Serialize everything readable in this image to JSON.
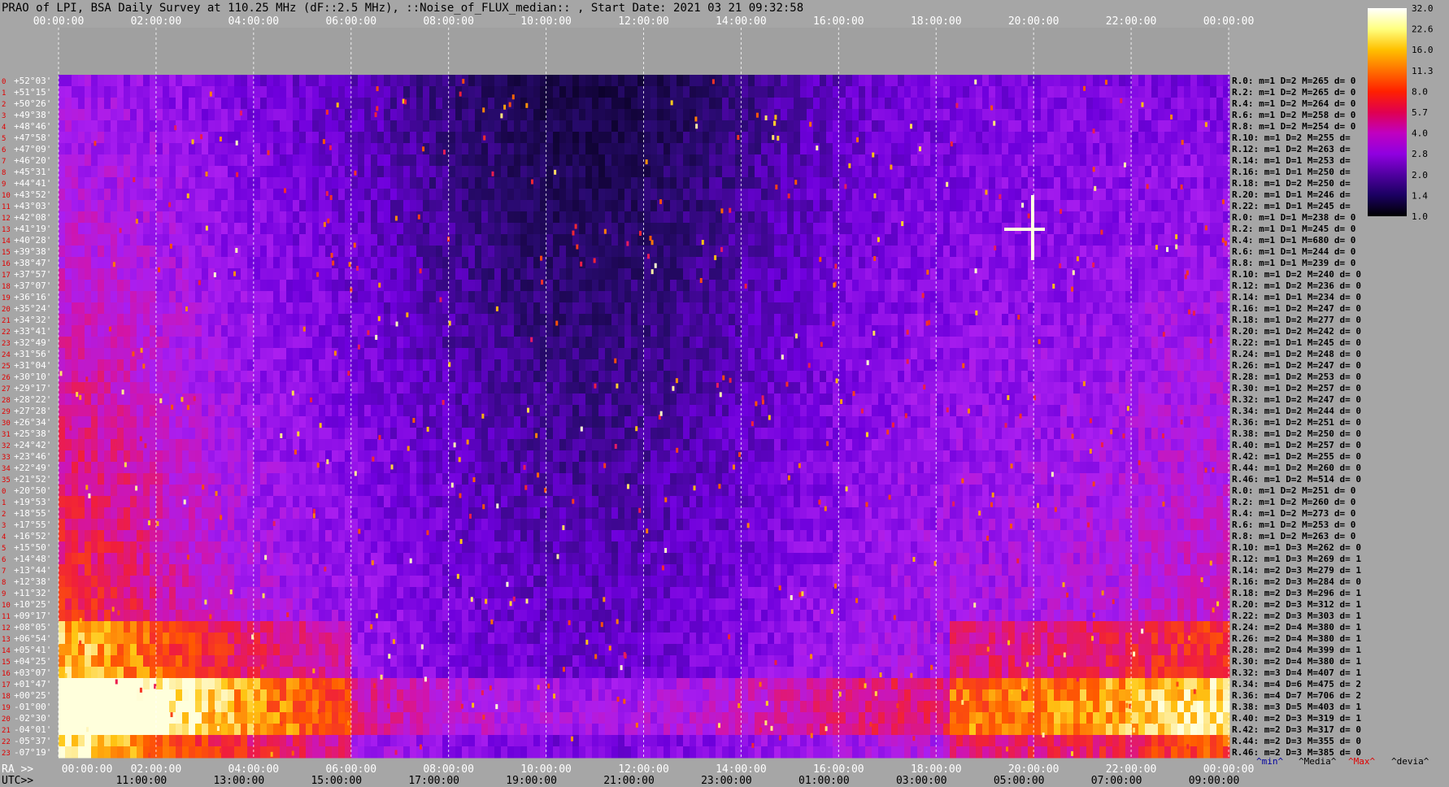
{
  "header": {
    "title": "PRAO of LPI, BSA Daily Survey at 110.25 MHz (dF::2.5 MHz), ::Noise_of_FLUX_median:: , Start Date: 2021 03 21 09:32:58"
  },
  "chart_data": {
    "type": "heatmap",
    "top_axis_ticks": [
      "00:00:00",
      "02:00:00",
      "04:00:00",
      "06:00:00",
      "08:00:00",
      "10:00:00",
      "12:00:00",
      "14:00:00",
      "16:00:00",
      "18:00:00",
      "20:00:00",
      "22:00:00",
      "00:00:00"
    ],
    "ra_axis": {
      "prefix": "RA >>",
      "ticks": [
        "00:00:00",
        "02:00:00",
        "04:00:00",
        "06:00:00",
        "08:00:00",
        "10:00:00",
        "12:00:00",
        "14:00:00",
        "16:00:00",
        "18:00:00",
        "20:00:00",
        "22:00:00",
        "00:00:00"
      ]
    },
    "utc_axis": {
      "prefix": "UTC>>",
      "ticks": [
        "11:00:00",
        "13:00:00",
        "15:00:00",
        "17:00:00",
        "19:00:00",
        "21:00:00",
        "23:00:00",
        "01:00:00",
        "03:00:00",
        "05:00:00",
        "07:00:00",
        "09:00:00"
      ]
    },
    "rows": [
      {
        "n": "0",
        "dec": "+52°03'",
        "s": "R.0: m=1 D=2 M=265 d= 0"
      },
      {
        "n": "1",
        "dec": "+51°15'",
        "s": "R.2: m=1 D=2 M=265 d= 0"
      },
      {
        "n": "2",
        "dec": "+50°26'",
        "s": "R.4: m=1 D=2 M=264 d= 0"
      },
      {
        "n": "3",
        "dec": "+49°38'",
        "s": "R.6: m=1 D=2 M=258 d= 0"
      },
      {
        "n": "4",
        "dec": "+48°46'",
        "s": "R.8: m=1 D=2 M=254 d= 0"
      },
      {
        "n": "5",
        "dec": "+47°58'",
        "s": "R.10: m=1 D=2 M=255 d="
      },
      {
        "n": "6",
        "dec": "+47°09'",
        "s": "R.12: m=1 D=2 M=263 d="
      },
      {
        "n": "7",
        "dec": "+46°20'",
        "s": "R.14: m=1 D=1 M=253 d="
      },
      {
        "n": "8",
        "dec": "+45°31'",
        "s": "R.16: m=1 D=1 M=250 d="
      },
      {
        "n": "9",
        "dec": "+44°41'",
        "s": "R.18: m=1 D=2 M=250 d="
      },
      {
        "n": "10",
        "dec": "+43°52'",
        "s": "R.20: m=1 D=1 M=246 d="
      },
      {
        "n": "11",
        "dec": "+43°03'",
        "s": "R.22: m=1 D=1 M=245 d="
      },
      {
        "n": "12",
        "dec": "+42°08'",
        "s": "R.0: m=1 D=1 M=238 d= 0"
      },
      {
        "n": "13",
        "dec": "+41°19'",
        "s": "R.2: m=1 D=1 M=245 d= 0"
      },
      {
        "n": "14",
        "dec": "+40°28'",
        "s": "R.4: m=1 D=1 M=680 d= 0"
      },
      {
        "n": "15",
        "dec": "+39°38'",
        "s": "R.6: m=1 D=1 M=244 d= 0"
      },
      {
        "n": "16",
        "dec": "+38°47'",
        "s": "R.8: m=1 D=1 M=239 d= 0"
      },
      {
        "n": "17",
        "dec": "+37°57'",
        "s": "R.10: m=1 D=2 M=240 d= 0"
      },
      {
        "n": "18",
        "dec": "+37°07'",
        "s": "R.12: m=1 D=2 M=236 d= 0"
      },
      {
        "n": "19",
        "dec": "+36°16'",
        "s": "R.14: m=1 D=1 M=234 d= 0"
      },
      {
        "n": "20",
        "dec": "+35°24'",
        "s": "R.16: m=1 D=2 M=247 d= 0"
      },
      {
        "n": "21",
        "dec": "+34°32'",
        "s": "R.18: m=1 D=2 M=277 d= 0"
      },
      {
        "n": "22",
        "dec": "+33°41'",
        "s": "R.20: m=1 D=2 M=242 d= 0"
      },
      {
        "n": "23",
        "dec": "+32°49'",
        "s": "R.22: m=1 D=1 M=245 d= 0"
      },
      {
        "n": "24",
        "dec": "+31°56'",
        "s": "R.24: m=1 D=2 M=248 d= 0"
      },
      {
        "n": "25",
        "dec": "+31°04'",
        "s": "R.26: m=1 D=2 M=247 d= 0"
      },
      {
        "n": "26",
        "dec": "+30°10'",
        "s": "R.28: m=1 D=2 M=253 d= 0"
      },
      {
        "n": "27",
        "dec": "+29°17'",
        "s": "R.30: m=1 D=2 M=257 d= 0"
      },
      {
        "n": "28",
        "dec": "+28°22'",
        "s": "R.32: m=1 D=2 M=247 d= 0"
      },
      {
        "n": "29",
        "dec": "+27°28'",
        "s": "R.34: m=1 D=2 M=244 d= 0"
      },
      {
        "n": "30",
        "dec": "+26°34'",
        "s": "R.36: m=1 D=2 M=251 d= 0"
      },
      {
        "n": "31",
        "dec": "+25°38'",
        "s": "R.38: m=1 D=2 M=250 d= 0"
      },
      {
        "n": "32",
        "dec": "+24°42'",
        "s": "R.40: m=1 D=2 M=257 d= 0"
      },
      {
        "n": "33",
        "dec": "+23°46'",
        "s": "R.42: m=1 D=2 M=255 d= 0"
      },
      {
        "n": "34",
        "dec": "+22°49'",
        "s": "R.44: m=1 D=2 M=260 d= 0"
      },
      {
        "n": "35",
        "dec": "+21°52'",
        "s": "R.46: m=1 D=2 M=514 d= 0"
      },
      {
        "n": "0",
        "dec": "+20°50'",
        "s": "R.0: m=1 D=2 M=251 d= 0"
      },
      {
        "n": "1",
        "dec": "+19°53'",
        "s": "R.2: m=1 D=2 M=260 d= 0"
      },
      {
        "n": "2",
        "dec": "+18°55'",
        "s": "R.4: m=1 D=2 M=273 d= 0"
      },
      {
        "n": "3",
        "dec": "+17°55'",
        "s": "R.6: m=1 D=2 M=253 d= 0"
      },
      {
        "n": "4",
        "dec": "+16°52'",
        "s": "R.8: m=1 D=2 M=263 d= 0"
      },
      {
        "n": "5",
        "dec": "+15°50'",
        "s": "R.10: m=1 D=3 M=262 d= 0"
      },
      {
        "n": "6",
        "dec": "+14°48'",
        "s": "R.12: m=1 D=3 M=269 d= 1"
      },
      {
        "n": "7",
        "dec": "+13°44'",
        "s": "R.14: m=2 D=3 M=279 d= 1"
      },
      {
        "n": "8",
        "dec": "+12°38'",
        "s": "R.16: m=2 D=3 M=284 d= 0"
      },
      {
        "n": "9",
        "dec": "+11°32'",
        "s": "R.18: m=2 D=3 M=296 d= 1"
      },
      {
        "n": "10",
        "dec": "+10°25'",
        "s": "R.20: m=2 D=3 M=312 d= 1"
      },
      {
        "n": "11",
        "dec": "+09°17'",
        "s": "R.22: m=2 D=3 M=303 d= 1"
      },
      {
        "n": "12",
        "dec": "+08°05'",
        "s": "R.24: m=2 D=4 M=380 d= 1"
      },
      {
        "n": "13",
        "dec": "+06°54'",
        "s": "R.26: m=2 D=4 M=380 d= 1"
      },
      {
        "n": "14",
        "dec": "+05°41'",
        "s": "R.28: m=2 D=4 M=399 d= 1"
      },
      {
        "n": "15",
        "dec": "+04°25'",
        "s": "R.30: m=2 D=4 M=380 d= 1"
      },
      {
        "n": "16",
        "dec": "+03°07'",
        "s": "R.32: m=3 D=4 M=407 d= 1"
      },
      {
        "n": "17",
        "dec": "+01°47'",
        "s": "R.34: m=4 D=6 M=475 d= 2"
      },
      {
        "n": "18",
        "dec": "+00°25'",
        "s": "R.36: m=4 D=7 M=706 d= 2"
      },
      {
        "n": "19",
        "dec": "-01°00'",
        "s": "R.38: m=3 D=5 M=403 d= 1"
      },
      {
        "n": "20",
        "dec": "-02°30'",
        "s": "R.40: m=2 D=3 M=319 d= 1"
      },
      {
        "n": "21",
        "dec": "-04°01'",
        "s": "R.42: m=2 D=3 M=317 d= 0"
      },
      {
        "n": "22",
        "dec": "-05°37'",
        "s": "R.44: m=2 D=3 M=355 d= 0"
      },
      {
        "n": "23",
        "dec": "-07°19'",
        "s": "R.46: m=2 D=3 M=385 d= 0"
      }
    ],
    "colorbar": {
      "ticks": [
        "32.0",
        "22.6",
        "16.0",
        "11.3",
        "8.0",
        "5.7",
        "4.0",
        "2.8",
        "2.0",
        "1.4",
        "1.0"
      ],
      "colors": [
        "#000000",
        "#1a0060",
        "#5000a0",
        "#9000e0",
        "#c000c0",
        "#e00050",
        "#ff2000",
        "#ff7000",
        "#ffc000",
        "#ffff80",
        "#ffffff"
      ]
    },
    "legend": [
      "^min^",
      "^Media^",
      "^Max^",
      "^devia^"
    ],
    "legend_colors": [
      "#0000a0",
      "#000000",
      "#e00000",
      "#000000"
    ]
  }
}
